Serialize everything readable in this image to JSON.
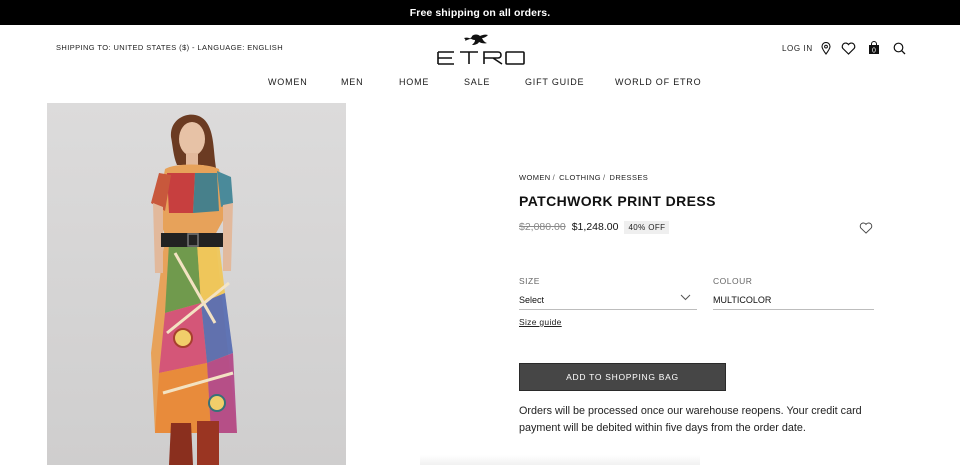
{
  "promo": {
    "text": "Free shipping on all orders."
  },
  "header": {
    "shipping_to_label": "SHIPPING TO:",
    "shipping_to_value": "UNITED STATES ($)",
    "separator": " - ",
    "language_label": "LANGUAGE:",
    "language_value": "ENGLISH",
    "logo_text": "ETRO",
    "login_label": "LOG IN",
    "bag_count": "0",
    "icons": [
      "location-pin-icon",
      "heart-icon",
      "shopping-bag-icon",
      "search-icon"
    ]
  },
  "nav": {
    "items": [
      {
        "label": "WOMEN"
      },
      {
        "label": "MEN"
      },
      {
        "label": "HOME"
      },
      {
        "label": "SALE"
      },
      {
        "label": "GIFT GUIDE"
      },
      {
        "label": "WORLD OF ETRO"
      }
    ]
  },
  "product": {
    "breadcrumb": [
      {
        "label": "WOMEN"
      },
      {
        "label": "CLOTHING"
      },
      {
        "label": "DRESSES"
      }
    ],
    "breadcrumb_separator": "/",
    "title": "PATCHWORK PRINT DRESS",
    "old_price": "$2,080.00",
    "new_price": "$1,248.00",
    "discount": "40% OFF",
    "size_label": "SIZE",
    "size_value": "Select",
    "colour_label": "COLOUR",
    "colour_value": "MULTICOLOR",
    "size_guide": "Size guide",
    "add_to_bag": "ADD TO SHOPPING BAG",
    "notice": "Orders will be processed once our warehouse reopens. Your credit card payment will be debited within five days from the order date."
  },
  "colors": {
    "promo_bg": "#000000",
    "button_bg": "#464646",
    "photo_bg": "#d4d3d3",
    "discount_bg": "#efefef"
  }
}
